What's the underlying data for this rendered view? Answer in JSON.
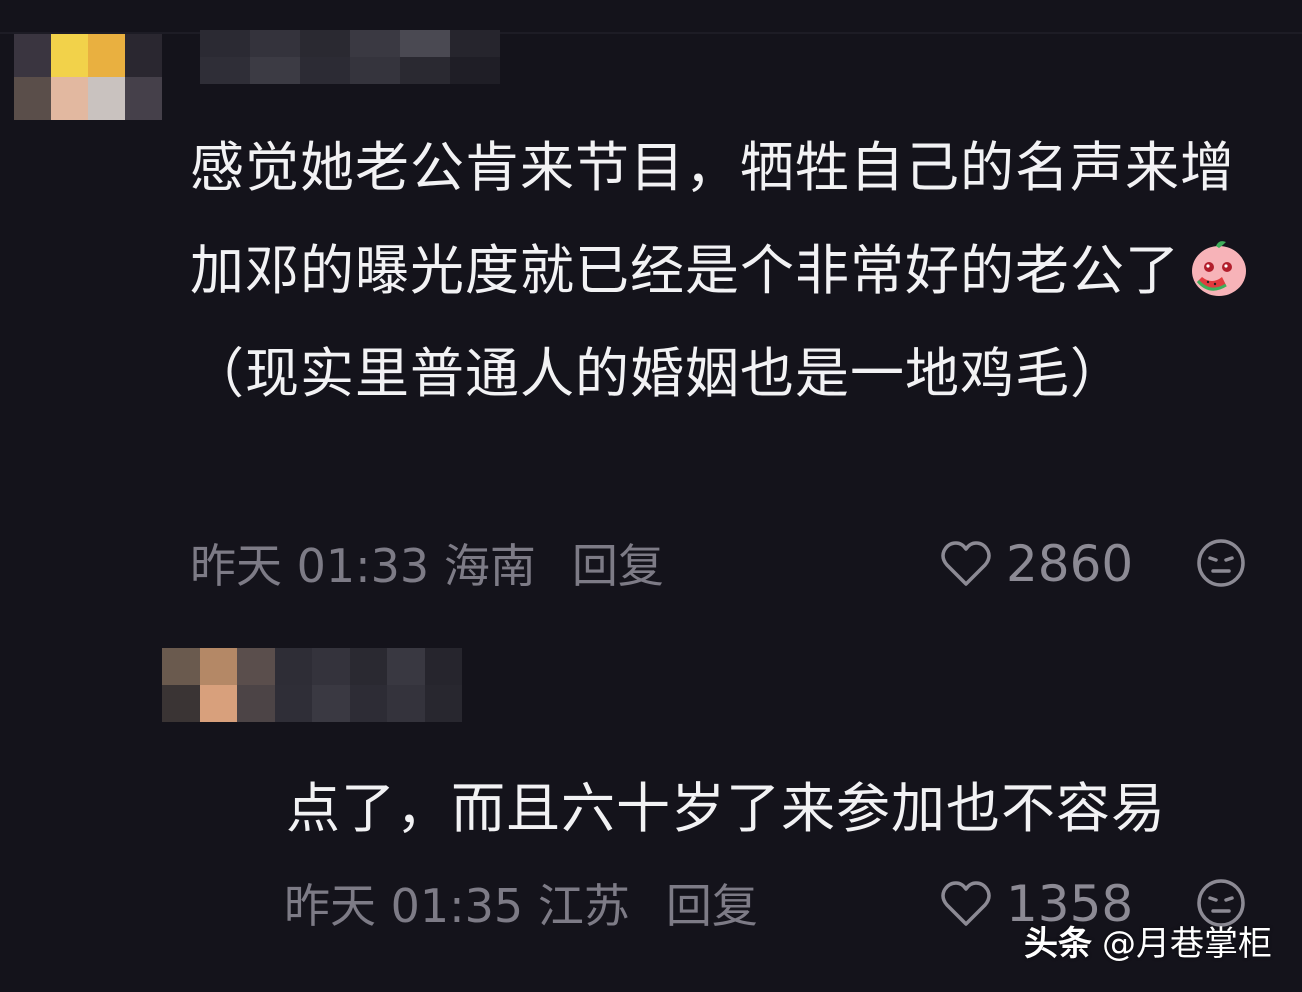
{
  "comments": [
    {
      "text_before_emoji": "感觉她老公肯来节目，牺牲自己的名声来增加邓的曝光度就已经是个非常好的老公了",
      "emoji": "watermelon-peach-emoji",
      "text_after_emoji": "（现实里普通人的婚姻也是一地鸡毛）",
      "time": "昨天 01:33",
      "location": "海南",
      "reply_label": "回复",
      "likes": "2860"
    },
    {
      "text": "点了，而且六十岁了来参加也不容易",
      "time": "昨天 01:35",
      "location": "江苏",
      "reply_label": "回复",
      "likes": "1358"
    }
  ],
  "watermark": {
    "brand": "头条",
    "account": "@月巷掌柜"
  },
  "colors": {
    "background": "#14131b",
    "text": "#f2f2f4",
    "meta": "#7d7b86",
    "like": "#8c8a94"
  },
  "icons": {
    "like": "heart-outline-icon",
    "dislike": "neutral-face-icon"
  }
}
